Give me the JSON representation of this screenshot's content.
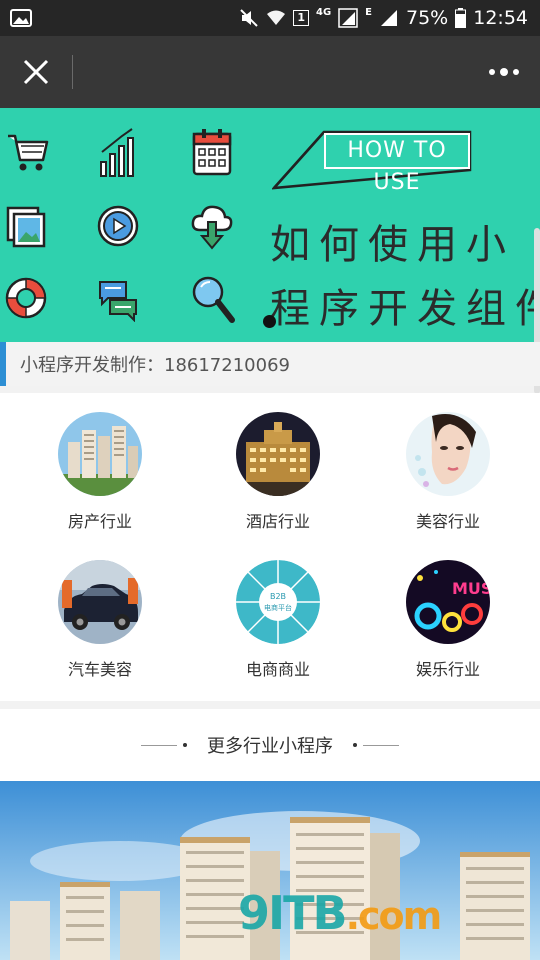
{
  "status_bar": {
    "battery_text": "75%",
    "time": "12:54",
    "network_label": "4G",
    "sim_badge": "1",
    "edge_label": "E"
  },
  "title_bar": {
    "close_icon": "close-icon",
    "more_icon": "more-dots-icon"
  },
  "banner": {
    "howto_text": "HOW TO USE",
    "title_line1": "如何使用小",
    "title_line2": "程序开发组件",
    "bg_color": "#2fd1ae",
    "icons": [
      "cart-icon",
      "bar-chart-icon",
      "calendar-icon",
      "picture-icon",
      "play-icon",
      "cloud-download-icon",
      "lifebuoy-icon",
      "chat-icon",
      "search-icon"
    ]
  },
  "contact": {
    "text": "小程序开发制作：18617210069",
    "accent_color": "#2d8fd4"
  },
  "industries": [
    {
      "label": "房产行业"
    },
    {
      "label": "酒店行业"
    },
    {
      "label": "美容行业"
    },
    {
      "label": "汽车美容"
    },
    {
      "label": "电商商业"
    },
    {
      "label": "娱乐行业"
    }
  ],
  "ecommerce_circle": {
    "line1": "B2B",
    "line2": "电商平台"
  },
  "more": {
    "text": "更多行业小程序"
  },
  "watermark": {
    "main": "9ITB",
    "suffix": ".com"
  }
}
